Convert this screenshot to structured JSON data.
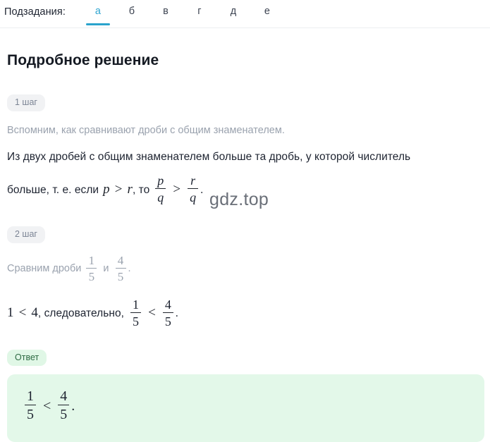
{
  "tabbar": {
    "label": "Подзадания:",
    "tabs": [
      {
        "id": "a",
        "label": "а",
        "active": true
      },
      {
        "id": "b",
        "label": "б",
        "active": false
      },
      {
        "id": "v",
        "label": "в",
        "active": false
      },
      {
        "id": "g",
        "label": "г",
        "active": false
      },
      {
        "id": "d",
        "label": "д",
        "active": false
      },
      {
        "id": "e",
        "label": "е",
        "active": false
      }
    ],
    "active_color": "#2aa3cc"
  },
  "page_title": "Подробное решение",
  "step1": {
    "badge": "1 шаг",
    "note": "Вспомним, как сравнивают дроби с общим знаменателем.",
    "statement_line1": "Из двух дробей с общим знаменателем больше та дробь, у которой числитель",
    "statement_line2_prefix": "больше, т. е. если",
    "var_p": "p",
    "rel_gt": ">",
    "var_r": "r",
    "then_word": ", то",
    "frac1": {
      "num": "p",
      "den": "q"
    },
    "frac2": {
      "num": "r",
      "den": "q"
    },
    "period": "."
  },
  "step2": {
    "badge": "2 шаг",
    "compare_prefix": "Сравним дроби",
    "frac1": {
      "num": "1",
      "den": "5"
    },
    "conj": "и",
    "frac2": {
      "num": "4",
      "den": "5"
    },
    "period": ".",
    "conclusion_prefix_num1": "1",
    "conclusion_rel": "<",
    "conclusion_prefix_num2": "4",
    "conclusion_word": ", следовательно,",
    "cfrac1": {
      "num": "1",
      "den": "5"
    },
    "cfrac2": {
      "num": "4",
      "den": "5"
    },
    "conclusion_period": "."
  },
  "answer": {
    "badge": "Ответ",
    "frac1": {
      "num": "1",
      "den": "5"
    },
    "rel": "<",
    "frac2": {
      "num": "4",
      "den": "5"
    },
    "period": ".",
    "bg_color": "#e3f8e9"
  },
  "watermark": "gdz.top"
}
